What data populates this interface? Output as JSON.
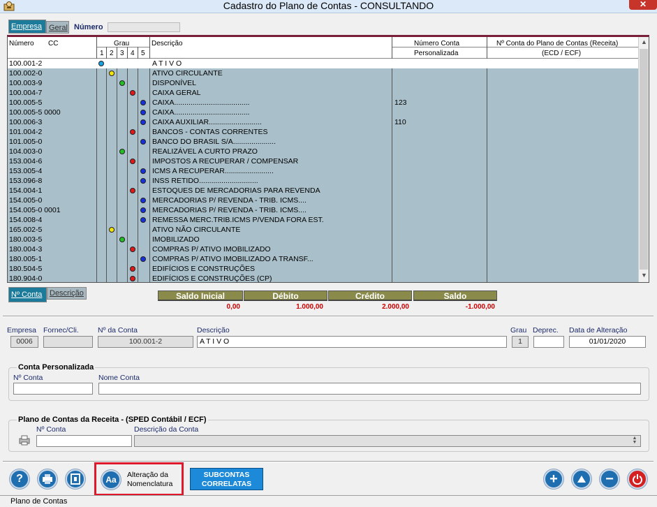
{
  "window": {
    "title": "Cadastro do Plano de Contas   -   CONSULTANDO",
    "close_label": "✕"
  },
  "tabs_top": [
    {
      "label": "Empresa"
    },
    {
      "label": "Geral"
    }
  ],
  "numero_label": "Número",
  "grid": {
    "headers": {
      "numero": "Número",
      "cc": "CC",
      "grau": "Grau",
      "grau_levels": [
        "1",
        "2",
        "3",
        "4",
        "5"
      ],
      "descricao": "Descrição",
      "conta_pers_1": "Número Conta",
      "conta_pers_2": "Personalizada",
      "conta_receita_1": "Nº Conta do Plano de Contas (Receita)",
      "conta_receita_2": "(ECD / ECF)"
    },
    "rows": [
      {
        "numero": "100.001-2",
        "grau": 1,
        "color": "#18a3e0",
        "descricao": "A T I V O",
        "pers": ""
      },
      {
        "numero": "100.002-0",
        "grau": 2,
        "color": "#f5e400",
        "descricao": "ATIVO CIRCULANTE",
        "pers": ""
      },
      {
        "numero": "100.003-9",
        "grau": 3,
        "color": "#22c022",
        "descricao": "DISPONÍVEL",
        "pers": ""
      },
      {
        "numero": "100.004-7",
        "grau": 4,
        "color": "#e01818",
        "descricao": "CAIXA GERAL",
        "pers": ""
      },
      {
        "numero": "100.005-5",
        "grau": 5,
        "color": "#1830d8",
        "descricao": "CAIXA.....................................",
        "pers": "123"
      },
      {
        "numero": "100.005-5 0000",
        "grau": 5,
        "color": "#1830d8",
        "descricao": "CAIXA.....................................",
        "pers": ""
      },
      {
        "numero": "100.006-3",
        "grau": 5,
        "color": "#1830d8",
        "descricao": "CAIXA AUXILIAR..........................",
        "pers": "110"
      },
      {
        "numero": "101.004-2",
        "grau": 4,
        "color": "#e01818",
        "descricao": "BANCOS - CONTAS CORRENTES",
        "pers": ""
      },
      {
        "numero": "101.005-0",
        "grau": 5,
        "color": "#1830d8",
        "descricao": "BANCO DO BRASIL S/A.....................",
        "pers": ""
      },
      {
        "numero": "104.003-0",
        "grau": 3,
        "color": "#22c022",
        "descricao": "REALIZÁVEL A CURTO PRAZO",
        "pers": ""
      },
      {
        "numero": "153.004-6",
        "grau": 4,
        "color": "#e01818",
        "descricao": "IMPOSTOS A RECUPERAR / COMPENSAR",
        "pers": ""
      },
      {
        "numero": "153.005-4",
        "grau": 5,
        "color": "#1830d8",
        "descricao": "ICMS A RECUPERAR........................",
        "pers": ""
      },
      {
        "numero": "153.096-8",
        "grau": 5,
        "color": "#1830d8",
        "descricao": "INSS RETIDO.............................",
        "pers": ""
      },
      {
        "numero": "154.004-1",
        "grau": 4,
        "color": "#e01818",
        "descricao": "ESTOQUES DE MERCADORIAS PARA REVENDA",
        "pers": ""
      },
      {
        "numero": "154.005-0",
        "grau": 5,
        "color": "#1830d8",
        "descricao": "MERCADORIAS P/ REVENDA - TRIB. ICMS....",
        "pers": ""
      },
      {
        "numero": "154.005-0 0001",
        "grau": 5,
        "color": "#1830d8",
        "descricao": "MERCADORIAS P/ REVENDA - TRIB. ICMS....",
        "pers": ""
      },
      {
        "numero": "154.008-4",
        "grau": 5,
        "color": "#1830d8",
        "descricao": "REMESSA MERC.TRIB.ICMS P/VENDA FORA EST.",
        "pers": ""
      },
      {
        "numero": "165.002-5",
        "grau": 2,
        "color": "#f5e400",
        "descricao": "ATIVO NÃO CIRCULANTE",
        "pers": ""
      },
      {
        "numero": "180.003-5",
        "grau": 3,
        "color": "#22c022",
        "descricao": "IMOBILIZADO",
        "pers": ""
      },
      {
        "numero": "180.004-3",
        "grau": 4,
        "color": "#e01818",
        "descricao": "COMPRAS P/ ATIVO IMOBILIZADO",
        "pers": ""
      },
      {
        "numero": "180.005-1",
        "grau": 5,
        "color": "#1830d8",
        "descricao": "COMPRAS P/ ATIVO IMOBILIZADO A TRANSF...",
        "pers": ""
      },
      {
        "numero": "180.504-5",
        "grau": 4,
        "color": "#e01818",
        "descricao": "EDIFÍCIOS E CONSTRUÇÕES",
        "pers": ""
      },
      {
        "numero": "180.904-0",
        "grau": 4,
        "color": "#e01818",
        "descricao": "EDIFÍCIOS E CONSTRUÇÕES (CP)",
        "pers": ""
      }
    ]
  },
  "tabs_bottom": [
    {
      "label": "Nº Conta"
    },
    {
      "label": "Descrição"
    }
  ],
  "summary": [
    {
      "label": "Saldo Inicial",
      "value": "0,00"
    },
    {
      "label": "Débito",
      "value": "1.000,00"
    },
    {
      "label": "Crédito",
      "value": "2.000,00"
    },
    {
      "label": "Saldo",
      "value": "-1.000,00"
    }
  ],
  "detail": {
    "empresa_label": "Empresa",
    "empresa_value": "0006",
    "fornec_label": "Fornec/Cli.",
    "fornec_value": "",
    "conta_label": "Nº da Conta",
    "conta_value": "100.001-2",
    "descricao_label": "Descrição",
    "descricao_value": "A T I V O",
    "grau_label": "Grau",
    "grau_value": "1",
    "deprec_label": "Deprec.",
    "deprec_value": "",
    "data_label": "Data de Alteração",
    "data_value": "01/01/2020"
  },
  "conta_pers": {
    "title": "Conta Personalizada",
    "num_label": "Nº Conta",
    "num_value": "",
    "nome_label": "Nome Conta",
    "nome_value": ""
  },
  "plano_receita": {
    "title": "Plano de Contas da Receita - (SPED Contábil / ECF)",
    "num_label": "Nº Conta",
    "num_value": "",
    "desc_label": "Descrição da Conta",
    "desc_value": ""
  },
  "toolbar": {
    "alteracao_line1": "Alteração da",
    "alteracao_line2": "Nomenclatura",
    "alteracao_icon": "Aa",
    "subcontas_line1": "SUBCONTAS",
    "subcontas_line2": "CORRELATAS",
    "help": "?",
    "add": "+",
    "remove": "−"
  },
  "status": "Plano de Contas"
}
